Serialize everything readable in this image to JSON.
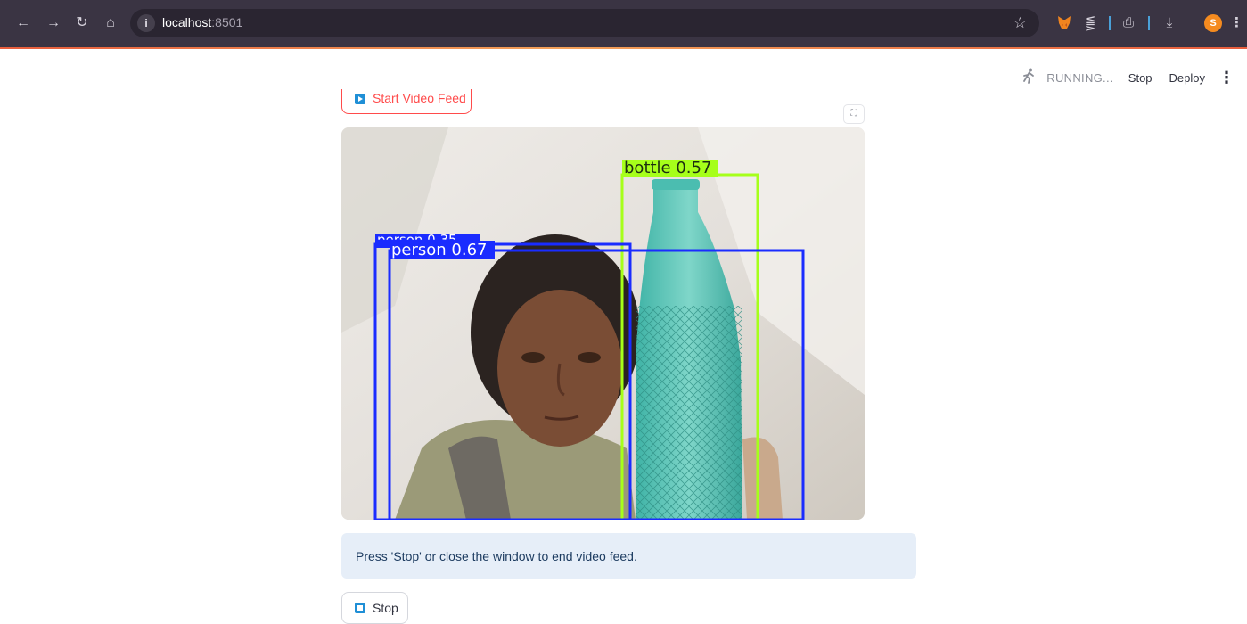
{
  "browser": {
    "url_host": "localhost",
    "url_port": ":8501",
    "profile_initial": "S",
    "icons": {
      "back": "←",
      "forward": "→",
      "reload": "↻",
      "home": "⌂",
      "info": "i",
      "star": "☆",
      "extensions": "⪋",
      "print": "⎙",
      "download": "⤓",
      "menu": "⋮"
    }
  },
  "app": {
    "status": {
      "running_label": "RUNNING...",
      "stop_label": "Stop",
      "deploy_label": "Deploy",
      "menu_icon": "⋮",
      "runner_icon": "🏃"
    },
    "start_button_label": "Start Video Feed",
    "fullscreen_icon": "⛶",
    "detections": [
      {
        "label": "bottle 0.57",
        "color": "#a6ff1a"
      },
      {
        "label": "person 0.35",
        "color": "#1a2cff"
      },
      {
        "label": "person 0.67",
        "color": "#1a2cff"
      }
    ],
    "info_message": "Press 'Stop' or close the window to end video feed.",
    "stop_button_label": "Stop"
  }
}
